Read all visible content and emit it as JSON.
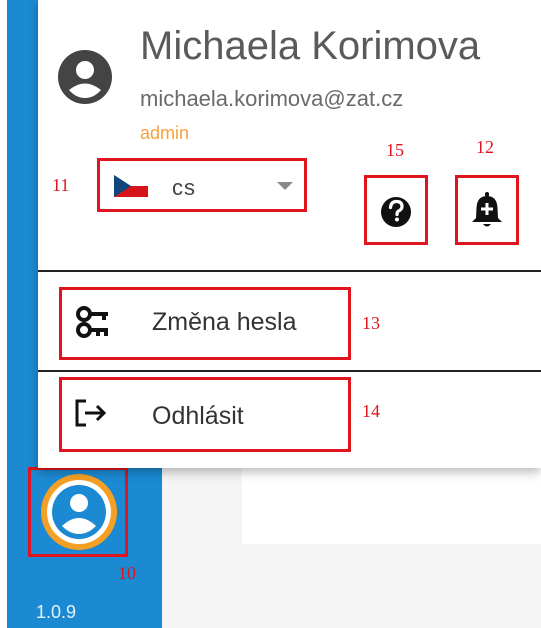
{
  "user": {
    "name": "Michaela Korimova",
    "email": "michaela.korimova@zat.cz",
    "role": "admin"
  },
  "language": {
    "value": "cs",
    "flag": "czech-flag-icon"
  },
  "menu": {
    "change_password": "Změna hesla",
    "logout": "Odhlásit"
  },
  "annotations": {
    "n10": "10",
    "n11": "11",
    "n12": "12",
    "n13": "13",
    "n14": "14",
    "n15": "15"
  },
  "app": {
    "version": "1.0.9"
  },
  "colors": {
    "sidebar": "#1b8ad3",
    "role": "#f6a13d",
    "highlight": "#e0141e",
    "avatar_ring": "#f5a024"
  },
  "icons": [
    "account-circle-icon",
    "help-icon",
    "bell-plus-icon",
    "key-icon",
    "logout-icon",
    "user-avatar-icon",
    "chevron-down-icon"
  ]
}
